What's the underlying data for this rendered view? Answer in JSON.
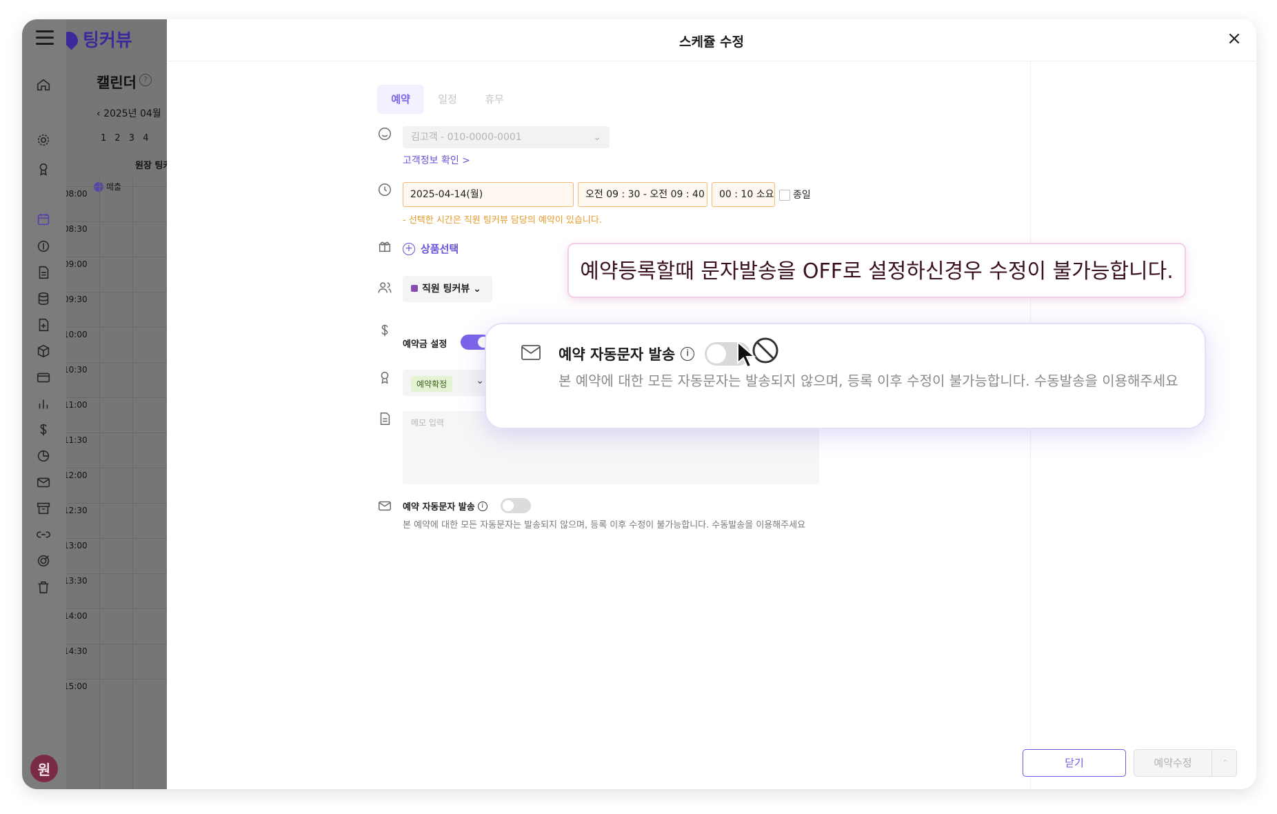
{
  "app": {
    "logo_text": "팅커뷰",
    "avatar_initial": "원"
  },
  "background": {
    "page_title": "캘린더",
    "date_nav": "2025년 04월",
    "week_tabs": "1 2 3 4",
    "staff_column": "원장 팅커",
    "sales_label": "매출",
    "times": [
      "08:00",
      "08:30",
      "09:00",
      "09:30",
      "10:00",
      "10:30",
      "11:00",
      "11:30",
      "12:00",
      "12:30",
      "13:00",
      "13:30",
      "14:00",
      "14:30",
      "15:00"
    ]
  },
  "modal": {
    "title": "스케쥴 수정",
    "close_icon": "×",
    "tabs": [
      {
        "label": "예약",
        "active": true
      },
      {
        "label": "일정",
        "active": false
      },
      {
        "label": "휴무",
        "active": false
      }
    ],
    "customer": {
      "value": "김고객 - 010-0000-0001",
      "info_link": "고객정보 확인 >"
    },
    "datetime": {
      "date": "2025-04-14(월)",
      "time_range": "오전 09 : 30 - 오전 09 : 40",
      "duration": "00 : 10 소요",
      "allday_label": "종일",
      "warning": "- 선택한 시간은 직원 팅커뷰 담당의 예약이 있습니다."
    },
    "product_button": "상품선택",
    "staff_select": "직원 팅커뷰",
    "deposit": {
      "label": "예약금 설정",
      "enabled": true
    },
    "status_badge": "예약확정",
    "memo_placeholder": "메모 입력",
    "sms": {
      "label": "예약 자동문자 발송",
      "info_icon": "i",
      "enabled": false,
      "description": "본 예약에 대한 모든 자동문자는 발송되지 않으며, 등록 이후 수정이 불가능합니다. 수동발송을 이용해주세요"
    },
    "buttons": {
      "close": "닫기",
      "save": "예약수정",
      "split_arrow": "⌃"
    }
  },
  "annotation": {
    "callout": "예약등록할때 문자발송을 OFF로 설정하신경우 수정이 불가능합니다.",
    "zoom_label": "예약 자동문자 발송",
    "zoom_description": "본 예약에 대한 모든 자동문자는 발송되지 않으며, 등록 이후 수정이 불가능합니다. 수동발송을 이용해주세요"
  },
  "colors": {
    "accent": "#7b63e8",
    "warning": "#e89a2a",
    "status_badge_bg": "#e4f3d4"
  }
}
